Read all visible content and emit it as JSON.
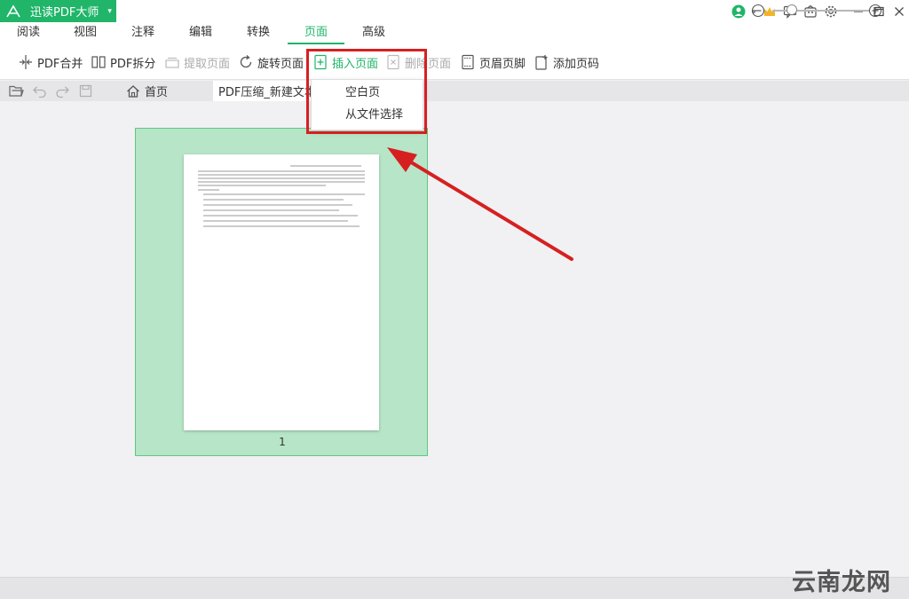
{
  "app": {
    "title": "迅读PDF大师"
  },
  "menu_tabs": [
    "阅读",
    "视图",
    "注释",
    "编辑",
    "转换",
    "页面",
    "高级"
  ],
  "toolbar": {
    "merge": "PDF合并",
    "split": "PDF拆分",
    "extract": "提取页面",
    "rotate": "旋转页面",
    "insert": "插入页面",
    "delete": "删除页面",
    "header_footer": "页眉页脚",
    "add_page_number": "添加页码"
  },
  "tabs": {
    "home": "首页",
    "file": "PDF压缩_新建文本文"
  },
  "dropdown": {
    "blank_page": "空白页",
    "from_file": "从文件选择"
  },
  "page": {
    "number": "1"
  },
  "watermark": "云南龙网",
  "colors": {
    "brand": "#20b569",
    "highlight": "#d62020",
    "selected_page": "#b7e5c7"
  }
}
